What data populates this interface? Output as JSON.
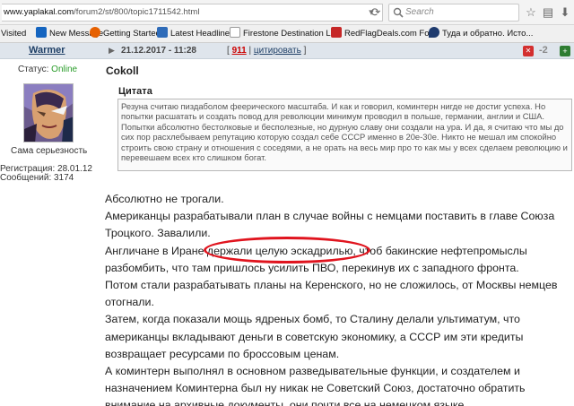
{
  "browser": {
    "url_host": "www.yaplakal.com",
    "url_path": "/forum2/st/800/topic1711542.html",
    "search_placeholder": "Search"
  },
  "bookmarks": [
    {
      "label": "Visited",
      "icon": "none"
    },
    {
      "label": "New Message",
      "icon": "outlook-icon",
      "color": "#1565c0"
    },
    {
      "label": "Getting Started",
      "icon": "firefox-icon",
      "color": "#e66000"
    },
    {
      "label": "Latest Headlines",
      "icon": "rss-icon",
      "color": "#2e6bb8"
    },
    {
      "label": "Firestone Destination L...",
      "icon": "page-icon",
      "color": "#999999"
    },
    {
      "label": "RedFlagDeals.com For...",
      "icon": "rfd-icon",
      "color": "#c62828"
    },
    {
      "label": "Туда и обратно. Исто...",
      "icon": "pin-icon",
      "color": "#1f3b6e"
    }
  ],
  "post": {
    "author": "Warmer",
    "date": "21.12.2017 - 11:28",
    "number": "911",
    "quote_link": "цитировать",
    "rating": "-2"
  },
  "user": {
    "status_label": "Статус:",
    "status_value": "Online",
    "title": "Сама серьезность",
    "registration": "Регистрация: 28.01.12",
    "messages": "Сообщений: 3174"
  },
  "quote": {
    "author": "Cokoll",
    "label": "Цитата",
    "text": "Резуна считаю пиздаболом феерического масштаба. И как и говорил, коминтерн нигде не достиг успеха. Но попытки расшатать и создать повод для революции минимум проводил в польше, германии, англии и США. Попытки абсолютно бестолковые и бесполезные, но дурную славу они создали на ура. И да, я считаю что мы до сих пор расхлебываем репутацию которую создал себе СССР именно в 20е-30е. Никто не мешал им спокойно строить свою страну и отношения с соседями, а не орать на весь мир про то как мы у всех сделаем революцию и перевешаем всех кто слишком богат."
  },
  "body_paragraphs": [
    "Абсолютно не трогали.",
    "Американцы разрабатывали план в случае войны с немцами поставить в главе Союза Троцкого. Завалили.",
    "Англичане в Иране держали целую эскадрилью, чтоб бакинские нефтепромыслы разбомбить, что там пришлось усилить ПВО, перекинув их с западного фронта.",
    "Потом стали разрабатывать планы на Керенского, но не сложилось, от Москвы немцев отогнали.",
    "Затем, когда показали мощь ядреных бомб, то Сталину делали ультиматум, что американцы вкладывают деньги в советскую экономику, а СССР им эти кредиты возвращает ресурсами по броссовым ценам.",
    "А коминтерн выполнял в основном разведывательные функции, и создателем и назначением Коминтерна был ну никак не Советский Союз, достаточно обратить внимание на архивные документы, они почти все на немецком языке."
  ],
  "colors": {
    "highlight_ellipse": "#e0141e",
    "online": "#2a9d2a",
    "post_number": "#cc0000"
  }
}
